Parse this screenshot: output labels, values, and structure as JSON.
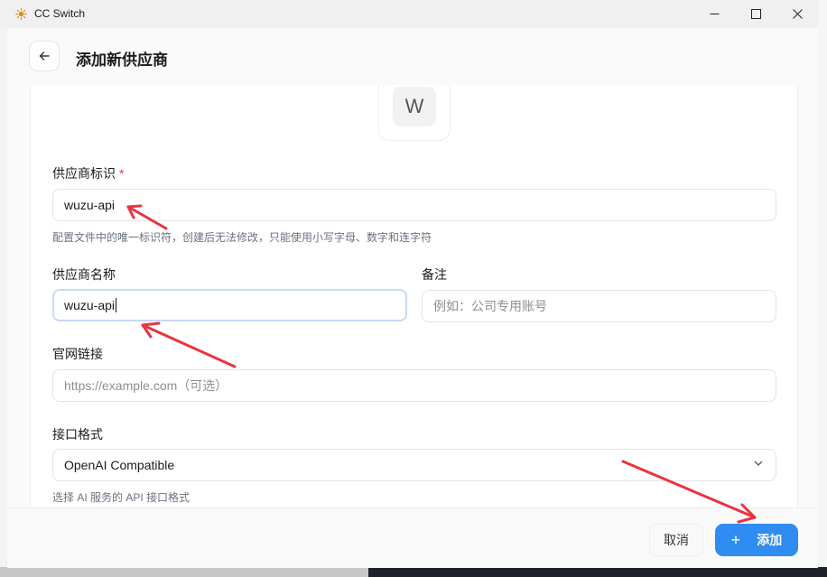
{
  "window": {
    "title": "CC Switch"
  },
  "header": {
    "title": "添加新供应商"
  },
  "avatar": {
    "letter": "W"
  },
  "form": {
    "provider_id": {
      "label": "供应商标识",
      "required_mark": "*",
      "value": "wuzu-api",
      "hint": "配置文件中的唯一标识符，创建后无法修改，只能使用小写字母、数字和连字符"
    },
    "provider_name": {
      "label": "供应商名称",
      "value": "wuzu-api"
    },
    "note": {
      "label": "备注",
      "placeholder": "例如：公司专用账号"
    },
    "website": {
      "label": "官网链接",
      "placeholder": "https://example.com（可选）"
    },
    "api_format": {
      "label": "接口格式",
      "selected": "OpenAI Compatible",
      "hint": "选择 AI 服务的 API 接口格式"
    }
  },
  "footer": {
    "cancel_label": "取消",
    "add_label": "添加"
  },
  "colors": {
    "primary": "#2f8cf0",
    "required": "#e53935",
    "annotation_arrow": "#e8343f"
  },
  "icons": {
    "app": "cc-switch-sun-icon",
    "back": "arrow-left-icon",
    "select": "chevron-down-icon",
    "add": "plus-icon"
  }
}
